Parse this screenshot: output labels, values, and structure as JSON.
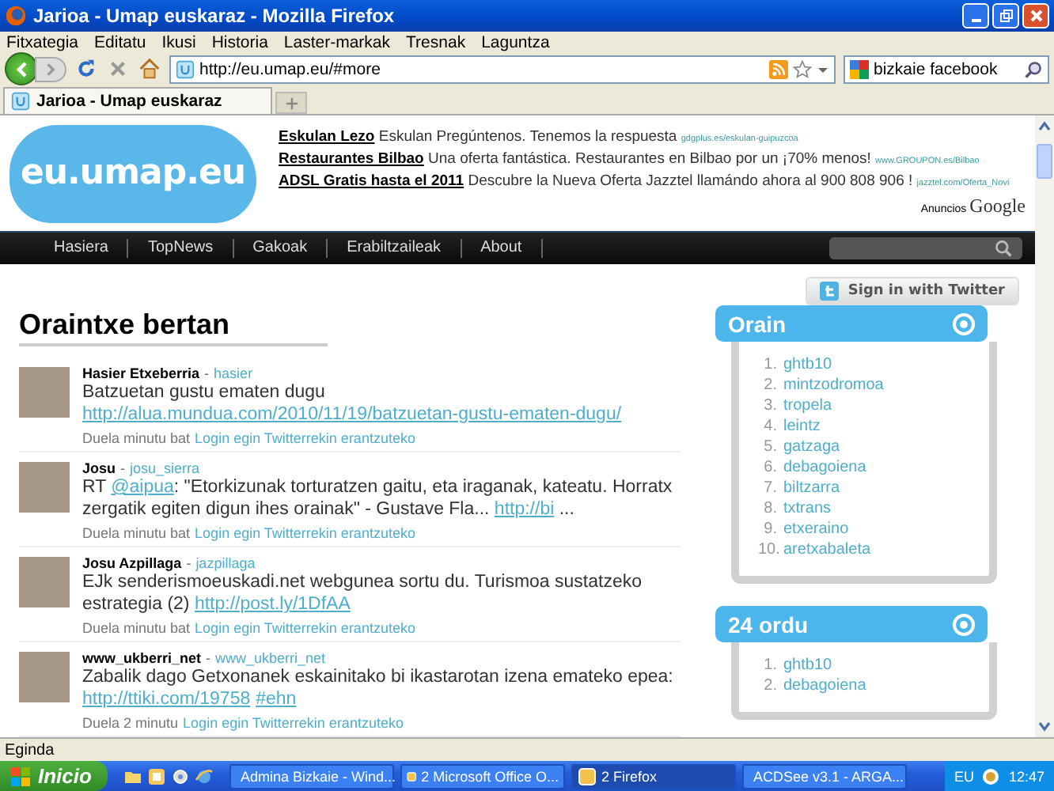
{
  "window": {
    "title": "Jarioa - Umap euskaraz - Mozilla Firefox"
  },
  "menu": [
    "Fitxategia",
    "Editatu",
    "Ikusi",
    "Historia",
    "Laster-markak",
    "Tresnak",
    "Laguntza"
  ],
  "toolbar": {
    "url": "http://eu.umap.eu/#more",
    "search": "bizkaie facebook"
  },
  "tabs": [
    {
      "label": "Jarioa - Umap euskaraz",
      "selected": true
    }
  ],
  "page": {
    "logo": "eu.umap.eu",
    "ads": [
      {
        "title": "Eskulan Lezo",
        "text": "Eskulan Pregúntenos. Tenemos la respuesta",
        "url": "gdgplus.es/eskulan-guipuzcoa"
      },
      {
        "title": "Restaurantes Bilbao",
        "text": "Una oferta fantástica. Restaurantes en Bilbao por un ¡70% menos!",
        "url": "www.GROUPON.es/Bilbao"
      },
      {
        "title": "ADSL Gratis hasta el 2011",
        "text": "Descubre la Nueva Oferta Jazztel llamándo ahora al 900 808 906 !",
        "url": "jazztel.com/Oferta_Novi"
      }
    ],
    "ads_label": "Anuncios",
    "ads_brand": "Google",
    "nav": [
      "Hasiera",
      "TopNews",
      "Gakoak",
      "Erabiltzaileak",
      "About"
    ],
    "sign_in": "Sign in with Twitter",
    "feed_title": "Oraintxe bertan",
    "tweets": [
      {
        "name": "Hasier Etxeberria",
        "sep": "-",
        "handle": "hasier",
        "segments": [
          {
            "text": "Batzuetan gustu ematen dugu ",
            "kind": "text"
          },
          {
            "text": "http://alua.mundua.com/2010/11/19/batzuetan-gustu-ematen-dugu/",
            "kind": "link"
          }
        ],
        "time": "Duela minutu bat",
        "reply": "Login egin Twitterrekin erantzuteko"
      },
      {
        "name": "Josu",
        "sep": "-",
        "handle": "josu_sierra",
        "segments": [
          {
            "text": "RT ",
            "kind": "text"
          },
          {
            "text": "@aipua",
            "kind": "link"
          },
          {
            "text": ": \"Etorkizunak torturatzen gaitu, eta iraganak, kateatu. Horratx zergatik egiten digun ihes orainak\" - Gustave Fla... ",
            "kind": "text"
          },
          {
            "text": "http://bi",
            "kind": "link"
          },
          {
            "text": " ...",
            "kind": "text"
          }
        ],
        "time": "Duela minutu bat",
        "reply": "Login egin Twitterrekin erantzuteko"
      },
      {
        "name": "Josu Azpillaga",
        "sep": "-",
        "handle": "jazpillaga",
        "segments": [
          {
            "text": "EJk senderismoeuskadi.net webgunea sortu du. Turismoa sustatzeko estrategia (2) ",
            "kind": "text"
          },
          {
            "text": "http://post.ly/1DfAA",
            "kind": "link"
          }
        ],
        "time": "Duela minutu bat",
        "reply": "Login egin Twitterrekin erantzuteko"
      },
      {
        "name": "www_ukberri_net",
        "sep": "-",
        "handle": "www_ukberri_net",
        "segments": [
          {
            "text": "Zabalik dago Getxonanek eskainitako bi ikastarotan izena emateko epea: ",
            "kind": "text"
          },
          {
            "text": "http://ttiki.com/19758",
            "kind": "link"
          },
          {
            "text": "#ehn",
            "kind": "link"
          }
        ],
        "time": "Duela 2 minutu",
        "reply": "Login egin Twitterrekin erantzuteko"
      }
    ],
    "widgets": [
      {
        "title": "Orain",
        "items": [
          {
            "rank": "1.",
            "name": "ghtb10"
          },
          {
            "rank": "2.",
            "name": "mintzodromoa"
          },
          {
            "rank": "3.",
            "name": "tropela"
          },
          {
            "rank": "4.",
            "name": "leintz"
          },
          {
            "rank": "5.",
            "name": "gatzaga"
          },
          {
            "rank": "6.",
            "name": "debagoiena"
          },
          {
            "rank": "7.",
            "name": "biltzarra"
          },
          {
            "rank": "8.",
            "name": "txtrans"
          },
          {
            "rank": "9.",
            "name": "etxeraino"
          },
          {
            "rank": "10.",
            "name": "aretxabaleta"
          }
        ]
      },
      {
        "title": "24 ordu",
        "items": [
          {
            "rank": "1.",
            "name": "ghtb10"
          },
          {
            "rank": "2.",
            "name": "debagoiena"
          }
        ]
      }
    ]
  },
  "status_bar": "Eginda",
  "taskbar": {
    "start": "Inicio",
    "tasks": [
      {
        "label": "Admina Bizkaie - Wind...",
        "selected": false
      },
      {
        "label": "2 Microsoft Office O...",
        "selected": false
      },
      {
        "label": "2 Firefox",
        "selected": true
      },
      {
        "label": "ACDSee v3.1 - ARGA...",
        "selected": false
      }
    ],
    "language": "EU",
    "clock": "12:47"
  }
}
